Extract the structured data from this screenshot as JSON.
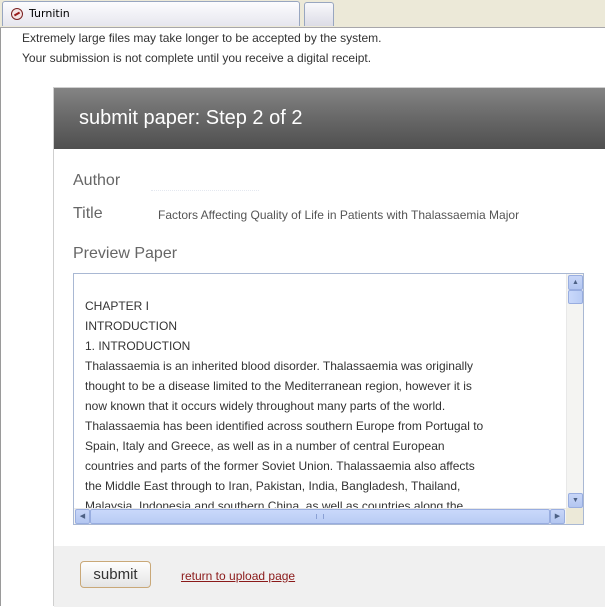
{
  "browser": {
    "tab_title": "Turnitin",
    "tab_icon": "turnitin-logo-icon"
  },
  "notes": {
    "line1": "Extremely large files may take longer to be accepted by the system.",
    "line2": "Your submission is not complete until you receive a digital receipt."
  },
  "panel": {
    "title": "submit paper: Step 2 of 2",
    "author_label": "Author",
    "author_value": "",
    "title_label": "Title",
    "title_value": "Factors Affecting Quality of Life in Patients with Thalassaemia Major",
    "preview_label": "Preview Paper",
    "preview_lines": [
      "CHAPTER I",
      "INTRODUCTION",
      "1. INTRODUCTION",
      "Thalassaemia is an inherited blood disorder. Thalassaemia was originally",
      "thought to be a disease limited to the Mediterranean region, however it is",
      "now known that it occurs widely throughout many parts of the world.",
      "Thalassaemia has been identified across southern Europe from Portugal to",
      "Spain, Italy and Greece, as well as in a number of central European",
      "countries and parts of the former Soviet Union. Thalassaemia also affects",
      "the Middle East through to Iran, Pakistan, India, Bangladesh, Thailand,",
      "Malaysia, Indonesia and southern China, as well as countries along the"
    ]
  },
  "footer": {
    "submit_label": "submit",
    "return_label": "return to upload page"
  },
  "colors": {
    "header_gradient_top": "#848484",
    "header_gradient_bottom": "#4f4f4f",
    "link": "#8b1a1a",
    "scrollbar": "#c0d0f5"
  }
}
